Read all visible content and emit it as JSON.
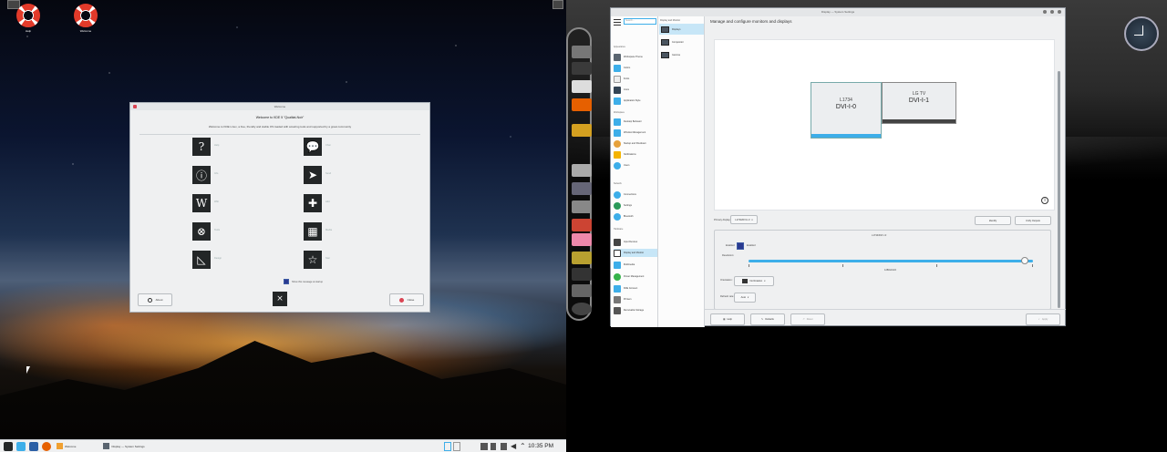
{
  "left_screen": {
    "desktop_icons": [
      {
        "label": "Help",
        "icon": "lifebuoy-icon"
      },
      {
        "label": "Welcome",
        "icon": "lifebuoy-icon"
      }
    ],
    "welcome_window": {
      "title": "Welcome",
      "heading": "Welcome to KDE 5 \"Qualitat-Noir\"",
      "subheading": "Welcome to KDE Linux, a free, friendly and stable OS loaded with amazing tools and supported by a great community",
      "icons": [
        {
          "name": "help-icon",
          "glyph": "?",
          "label": "Help"
        },
        {
          "name": "chat-icon",
          "glyph": "💬",
          "label": "Chat"
        },
        {
          "name": "info-icon",
          "glyph": "ⓘ",
          "label": "Info"
        },
        {
          "name": "send-icon",
          "glyph": "➤",
          "label": "Send"
        },
        {
          "name": "wiki-icon",
          "glyph": "W",
          "label": "Wiki"
        },
        {
          "name": "add-icon",
          "glyph": "✚",
          "label": "Add"
        },
        {
          "name": "tools-icon",
          "glyph": "⊗",
          "label": "Tools"
        },
        {
          "name": "media-icon",
          "glyph": "▦",
          "label": "Media"
        },
        {
          "name": "design-icon",
          "glyph": "◺",
          "label": "Design"
        },
        {
          "name": "star-icon",
          "glyph": "☆",
          "label": "Star"
        }
      ],
      "startup_checkbox_label": "Show this message at startup",
      "about_button": "About",
      "close_button": "Close"
    },
    "taskbar": {
      "tasks": [
        {
          "label": "Welcome"
        },
        {
          "label": "Display — System Settings"
        }
      ],
      "clock": "10:35 PM"
    }
  },
  "right_screen": {
    "settings_window": {
      "title": "Display — System Settings",
      "search_placeholder": "Search...",
      "header": "Manage and configure monitors and displays",
      "sidebar_categories": [
        "Appearance",
        "Workspace",
        "Personalization",
        "Network",
        "Hardware"
      ],
      "sidebar_items": [
        {
          "label": "Workspace Theme",
          "color": "#5a6570"
        },
        {
          "label": "Colors",
          "color": "#3daee9"
        },
        {
          "label": "Fonts",
          "color": "#eeeeee"
        },
        {
          "label": "Icons",
          "color": "#334455"
        },
        {
          "label": "Application Style",
          "color": "#3daee9"
        },
        {
          "label": "Desktop Behavior",
          "color": "#3daee9"
        },
        {
          "label": "Window Management",
          "color": "#e6a23c"
        },
        {
          "label": "Startup and Shutdown",
          "color": "#3daee9"
        },
        {
          "label": "Notifications",
          "color": "#f4b400"
        },
        {
          "label": "Users",
          "color": "#3daee9"
        },
        {
          "label": "Accessibility",
          "color": "#3daee9"
        },
        {
          "label": "Connections",
          "color": "#3daee9"
        },
        {
          "label": "Settings",
          "color": "#2b9a5a"
        },
        {
          "label": "Bluetooth",
          "color": "#3daee9"
        },
        {
          "label": "Input Devices",
          "color": "#444444"
        },
        {
          "label": "Display and Monitor",
          "color": "#ffffff"
        },
        {
          "label": "Multimedia",
          "color": "#3daee9"
        },
        {
          "label": "Power Management",
          "color": "#35b34a"
        },
        {
          "label": "KDE Connect",
          "color": "#3daee9"
        },
        {
          "label": "Printers",
          "color": "#777777"
        },
        {
          "label": "Removable Storage",
          "color": "#555555"
        }
      ],
      "sub_items": [
        {
          "label": "Displays"
        },
        {
          "label": "Compositor"
        },
        {
          "label": "Gamma"
        }
      ],
      "monitors": [
        {
          "name": "L1734",
          "connector": "DVI-I-0",
          "primary": true
        },
        {
          "name": "LG TV",
          "connector": "DVI-I-1",
          "primary": false
        }
      ],
      "primary_display_label": "Primary display:",
      "primary_display_value": "L1734/DVI-I-0",
      "identify_button": "Identify",
      "unify_button": "Unify Outputs",
      "group_title": "L1734/DVI-I-0",
      "enabled_label": "Enabled",
      "resolution_label": "Resolution:",
      "resolution_value": "1280x1024",
      "orientation_label": "Orientation:",
      "orientation_value": "No Rotation",
      "refresh_label": "Refresh rate:",
      "refresh_value": "Auto",
      "slider_fraction": 0.97,
      "help_button": "Help",
      "defaults_button": "Defaults",
      "reset_button": "Reset",
      "apply_button": "Apply"
    }
  },
  "colors": {
    "accent": "#3daee9",
    "window_bg": "#eff0f1",
    "close_red": "#da4453"
  }
}
